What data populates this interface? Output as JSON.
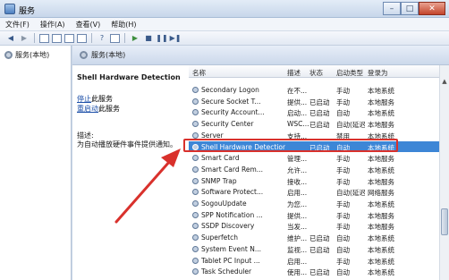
{
  "window": {
    "title": "服务"
  },
  "menu": [
    "文件(F)",
    "操作(A)",
    "查看(V)",
    "帮助(H)"
  ],
  "tree": {
    "node_label": "服务(本地)"
  },
  "panel": {
    "title": "服务(本地)"
  },
  "details": {
    "service_name": "Shell Hardware Detection",
    "stop_link": "停止",
    "stop_suffix": "此服务",
    "restart_link": "重启动",
    "restart_suffix": "此服务",
    "desc_label": "描述:",
    "desc_text": "为自动播放硬件事件提供通知。"
  },
  "columns": [
    "名称",
    "描述",
    "状态",
    "启动类型",
    "登录为"
  ],
  "rows": [
    {
      "name": "Secondary Logon",
      "desc": "在不...",
      "status": "",
      "startup": "手动",
      "logon": "本地系统"
    },
    {
      "name": "Secure Socket T...",
      "desc": "提供...",
      "status": "已启动",
      "startup": "手动",
      "logon": "本地服务"
    },
    {
      "name": "Security Account...",
      "desc": "启动...",
      "status": "已启动",
      "startup": "自动",
      "logon": "本地系统"
    },
    {
      "name": "Security Center",
      "desc": "WSC...",
      "status": "已启动",
      "startup": "自动(延迟...",
      "logon": "本地服务"
    },
    {
      "name": "Server",
      "desc": "支持...",
      "status": "",
      "startup": "禁用",
      "logon": "本地系统"
    },
    {
      "name": "Shell Hardware Detection",
      "desc": "",
      "status": "已启动",
      "startup": "自动",
      "logon": "本地系统"
    },
    {
      "name": "Smart Card",
      "desc": "管理...",
      "status": "",
      "startup": "手动",
      "logon": "本地服务"
    },
    {
      "name": "Smart Card Rem...",
      "desc": "允许...",
      "status": "",
      "startup": "手动",
      "logon": "本地系统"
    },
    {
      "name": "SNMP Trap",
      "desc": "接收...",
      "status": "",
      "startup": "手动",
      "logon": "本地服务"
    },
    {
      "name": "Software Protect...",
      "desc": "启用...",
      "status": "",
      "startup": "自动(延迟...",
      "logon": "网络服务"
    },
    {
      "name": "SogouUpdate",
      "desc": "为您...",
      "status": "",
      "startup": "手动",
      "logon": "本地系统"
    },
    {
      "name": "SPP Notification ...",
      "desc": "提供...",
      "status": "",
      "startup": "手动",
      "logon": "本地服务"
    },
    {
      "name": "SSDP Discovery",
      "desc": "当发...",
      "status": "",
      "startup": "手动",
      "logon": "本地服务"
    },
    {
      "name": "Superfetch",
      "desc": "维护...",
      "status": "已启动",
      "startup": "自动",
      "logon": "本地系统"
    },
    {
      "name": "System Event N...",
      "desc": "监视...",
      "status": "已启动",
      "startup": "自动",
      "logon": "本地系统"
    },
    {
      "name": "Tablet PC Input ...",
      "desc": "启用...",
      "status": "",
      "startup": "手动",
      "logon": "本地系统"
    },
    {
      "name": "Task Scheduler",
      "desc": "使用...",
      "status": "已启动",
      "startup": "自动",
      "logon": "本地系统"
    }
  ],
  "selected_row": "Shell Hardware Detection",
  "colors": {
    "selection": "#3d86d6",
    "highlight": "#d9312c"
  }
}
